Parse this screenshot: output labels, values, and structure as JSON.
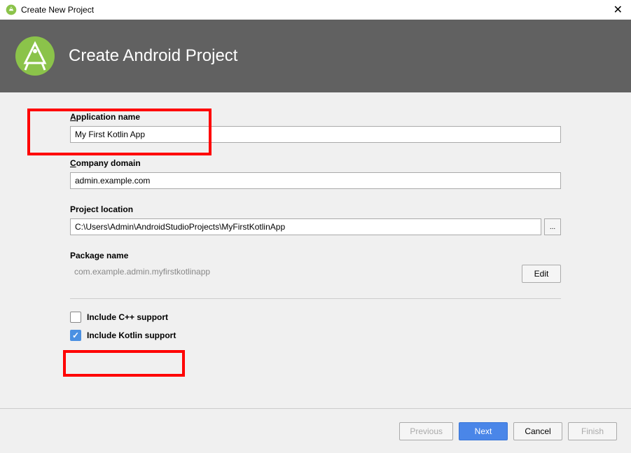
{
  "window": {
    "title": "Create New Project"
  },
  "header": {
    "title": "Create Android Project"
  },
  "form": {
    "app_name": {
      "label_prefix": "A",
      "label_rest": "pplication name",
      "value": "My First Kotlin App"
    },
    "company_domain": {
      "label_prefix": "C",
      "label_rest": "ompany domain",
      "value": "admin.example.com"
    },
    "project_location": {
      "label": "Project location",
      "value": "C:\\Users\\Admin\\AndroidStudioProjects\\MyFirstKotlinApp",
      "browse": "..."
    },
    "package_name": {
      "label": "Package name",
      "value": "com.example.admin.myfirstkotlinapp",
      "edit": "Edit"
    },
    "cpp_support": {
      "label": "Include C++ support",
      "checked": false
    },
    "kotlin_support": {
      "label": "Include Kotlin support",
      "checked": true
    }
  },
  "footer": {
    "previous": "Previous",
    "next": "Next",
    "cancel": "Cancel",
    "finish": "Finish"
  }
}
